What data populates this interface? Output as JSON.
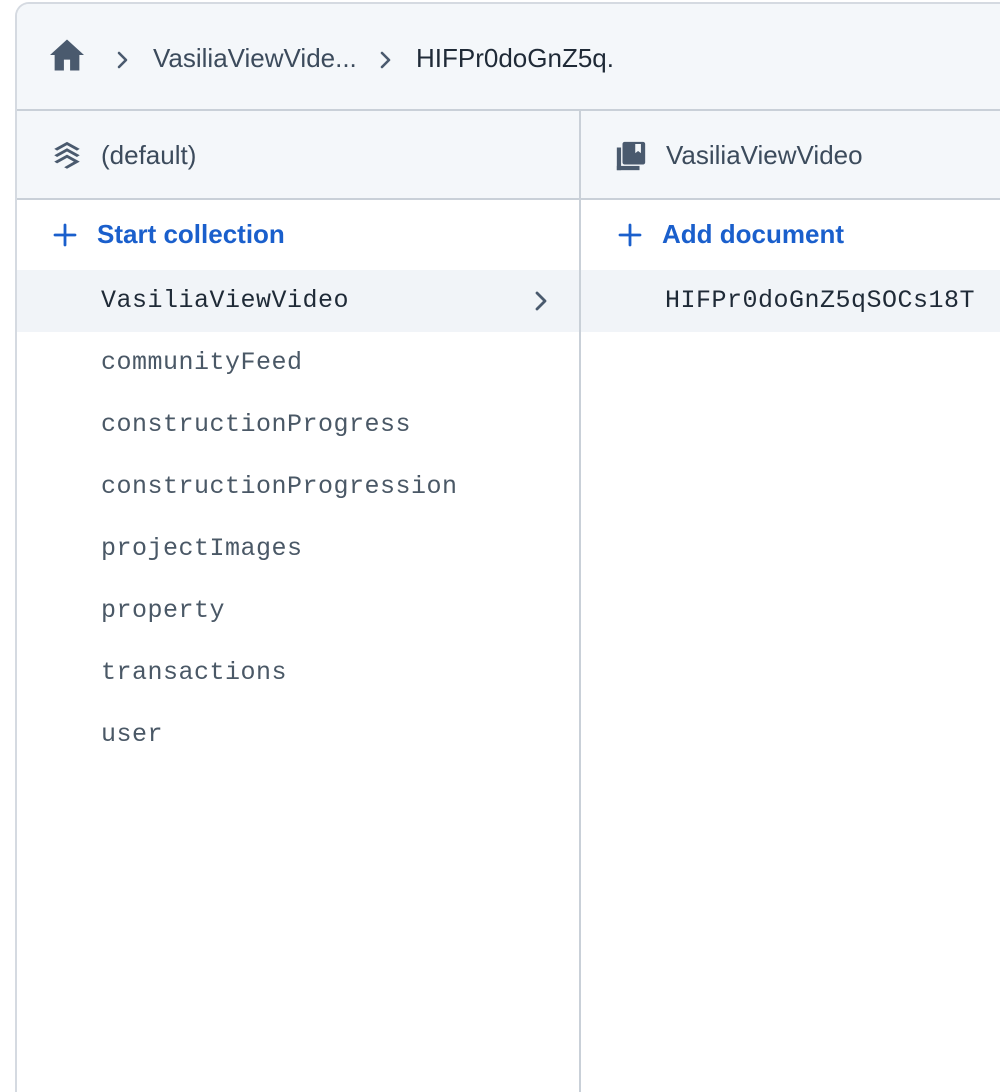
{
  "breadcrumb": {
    "home_icon": "home-icon",
    "separator_icon": "chevron-right-icon",
    "items": [
      "VasiliaViewVide...",
      "HIFPr0doGnZ5q."
    ]
  },
  "collections_panel": {
    "header_icon": "layers-icon",
    "header_title": "(default)",
    "action_icon": "plus-icon",
    "action_label": "Start collection",
    "items": [
      "VasiliaViewVideo",
      "communityFeed",
      "constructionProgress",
      "constructionProgression",
      "projectImages",
      "property",
      "transactions",
      "user"
    ],
    "selected_index": 0
  },
  "documents_panel": {
    "header_icon": "collection-icon",
    "header_title": "VasiliaViewVideo",
    "action_icon": "plus-icon",
    "action_label": "Add document",
    "items": [
      "HIFPr0doGnZ5qSOCs18T"
    ],
    "selected_index": 0
  },
  "colors": {
    "accent": "#1a5fcc",
    "header_bg": "#f4f7fa",
    "selected_bg": "#f1f4f8",
    "border": "#c9d0d8",
    "icon": "#4a5a6e"
  }
}
